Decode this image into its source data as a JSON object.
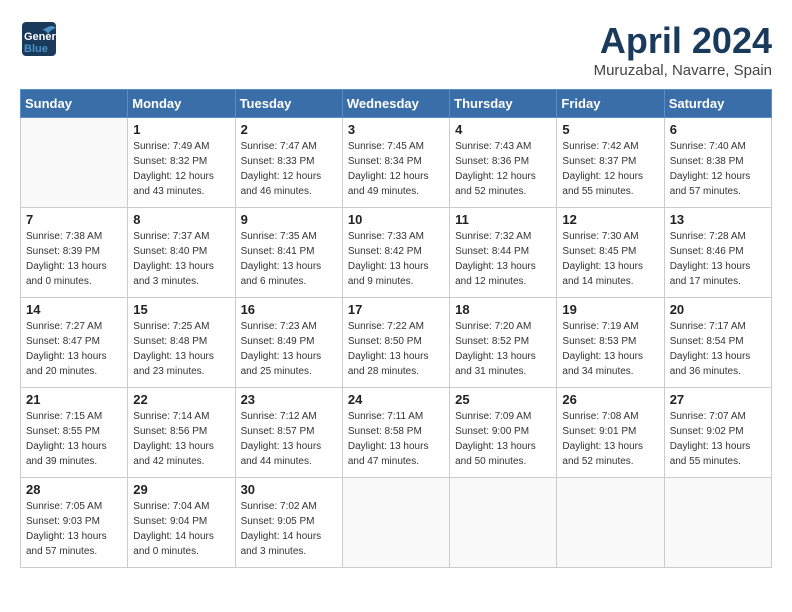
{
  "header": {
    "logo_line1": "General",
    "logo_line2": "Blue",
    "month": "April 2024",
    "location": "Muruzabal, Navarre, Spain"
  },
  "weekdays": [
    "Sunday",
    "Monday",
    "Tuesday",
    "Wednesday",
    "Thursday",
    "Friday",
    "Saturday"
  ],
  "weeks": [
    [
      {
        "day": "",
        "empty": true
      },
      {
        "day": "1",
        "sunrise": "Sunrise: 7:49 AM",
        "sunset": "Sunset: 8:32 PM",
        "daylight": "Daylight: 12 hours and 43 minutes."
      },
      {
        "day": "2",
        "sunrise": "Sunrise: 7:47 AM",
        "sunset": "Sunset: 8:33 PM",
        "daylight": "Daylight: 12 hours and 46 minutes."
      },
      {
        "day": "3",
        "sunrise": "Sunrise: 7:45 AM",
        "sunset": "Sunset: 8:34 PM",
        "daylight": "Daylight: 12 hours and 49 minutes."
      },
      {
        "day": "4",
        "sunrise": "Sunrise: 7:43 AM",
        "sunset": "Sunset: 8:36 PM",
        "daylight": "Daylight: 12 hours and 52 minutes."
      },
      {
        "day": "5",
        "sunrise": "Sunrise: 7:42 AM",
        "sunset": "Sunset: 8:37 PM",
        "daylight": "Daylight: 12 hours and 55 minutes."
      },
      {
        "day": "6",
        "sunrise": "Sunrise: 7:40 AM",
        "sunset": "Sunset: 8:38 PM",
        "daylight": "Daylight: 12 hours and 57 minutes."
      }
    ],
    [
      {
        "day": "7",
        "sunrise": "Sunrise: 7:38 AM",
        "sunset": "Sunset: 8:39 PM",
        "daylight": "Daylight: 13 hours and 0 minutes."
      },
      {
        "day": "8",
        "sunrise": "Sunrise: 7:37 AM",
        "sunset": "Sunset: 8:40 PM",
        "daylight": "Daylight: 13 hours and 3 minutes."
      },
      {
        "day": "9",
        "sunrise": "Sunrise: 7:35 AM",
        "sunset": "Sunset: 8:41 PM",
        "daylight": "Daylight: 13 hours and 6 minutes."
      },
      {
        "day": "10",
        "sunrise": "Sunrise: 7:33 AM",
        "sunset": "Sunset: 8:42 PM",
        "daylight": "Daylight: 13 hours and 9 minutes."
      },
      {
        "day": "11",
        "sunrise": "Sunrise: 7:32 AM",
        "sunset": "Sunset: 8:44 PM",
        "daylight": "Daylight: 13 hours and 12 minutes."
      },
      {
        "day": "12",
        "sunrise": "Sunrise: 7:30 AM",
        "sunset": "Sunset: 8:45 PM",
        "daylight": "Daylight: 13 hours and 14 minutes."
      },
      {
        "day": "13",
        "sunrise": "Sunrise: 7:28 AM",
        "sunset": "Sunset: 8:46 PM",
        "daylight": "Daylight: 13 hours and 17 minutes."
      }
    ],
    [
      {
        "day": "14",
        "sunrise": "Sunrise: 7:27 AM",
        "sunset": "Sunset: 8:47 PM",
        "daylight": "Daylight: 13 hours and 20 minutes."
      },
      {
        "day": "15",
        "sunrise": "Sunrise: 7:25 AM",
        "sunset": "Sunset: 8:48 PM",
        "daylight": "Daylight: 13 hours and 23 minutes."
      },
      {
        "day": "16",
        "sunrise": "Sunrise: 7:23 AM",
        "sunset": "Sunset: 8:49 PM",
        "daylight": "Daylight: 13 hours and 25 minutes."
      },
      {
        "day": "17",
        "sunrise": "Sunrise: 7:22 AM",
        "sunset": "Sunset: 8:50 PM",
        "daylight": "Daylight: 13 hours and 28 minutes."
      },
      {
        "day": "18",
        "sunrise": "Sunrise: 7:20 AM",
        "sunset": "Sunset: 8:52 PM",
        "daylight": "Daylight: 13 hours and 31 minutes."
      },
      {
        "day": "19",
        "sunrise": "Sunrise: 7:19 AM",
        "sunset": "Sunset: 8:53 PM",
        "daylight": "Daylight: 13 hours and 34 minutes."
      },
      {
        "day": "20",
        "sunrise": "Sunrise: 7:17 AM",
        "sunset": "Sunset: 8:54 PM",
        "daylight": "Daylight: 13 hours and 36 minutes."
      }
    ],
    [
      {
        "day": "21",
        "sunrise": "Sunrise: 7:15 AM",
        "sunset": "Sunset: 8:55 PM",
        "daylight": "Daylight: 13 hours and 39 minutes."
      },
      {
        "day": "22",
        "sunrise": "Sunrise: 7:14 AM",
        "sunset": "Sunset: 8:56 PM",
        "daylight": "Daylight: 13 hours and 42 minutes."
      },
      {
        "day": "23",
        "sunrise": "Sunrise: 7:12 AM",
        "sunset": "Sunset: 8:57 PM",
        "daylight": "Daylight: 13 hours and 44 minutes."
      },
      {
        "day": "24",
        "sunrise": "Sunrise: 7:11 AM",
        "sunset": "Sunset: 8:58 PM",
        "daylight": "Daylight: 13 hours and 47 minutes."
      },
      {
        "day": "25",
        "sunrise": "Sunrise: 7:09 AM",
        "sunset": "Sunset: 9:00 PM",
        "daylight": "Daylight: 13 hours and 50 minutes."
      },
      {
        "day": "26",
        "sunrise": "Sunrise: 7:08 AM",
        "sunset": "Sunset: 9:01 PM",
        "daylight": "Daylight: 13 hours and 52 minutes."
      },
      {
        "day": "27",
        "sunrise": "Sunrise: 7:07 AM",
        "sunset": "Sunset: 9:02 PM",
        "daylight": "Daylight: 13 hours and 55 minutes."
      }
    ],
    [
      {
        "day": "28",
        "sunrise": "Sunrise: 7:05 AM",
        "sunset": "Sunset: 9:03 PM",
        "daylight": "Daylight: 13 hours and 57 minutes."
      },
      {
        "day": "29",
        "sunrise": "Sunrise: 7:04 AM",
        "sunset": "Sunset: 9:04 PM",
        "daylight": "Daylight: 14 hours and 0 minutes."
      },
      {
        "day": "30",
        "sunrise": "Sunrise: 7:02 AM",
        "sunset": "Sunset: 9:05 PM",
        "daylight": "Daylight: 14 hours and 3 minutes."
      },
      {
        "day": "",
        "empty": true
      },
      {
        "day": "",
        "empty": true
      },
      {
        "day": "",
        "empty": true
      },
      {
        "day": "",
        "empty": true
      }
    ]
  ]
}
